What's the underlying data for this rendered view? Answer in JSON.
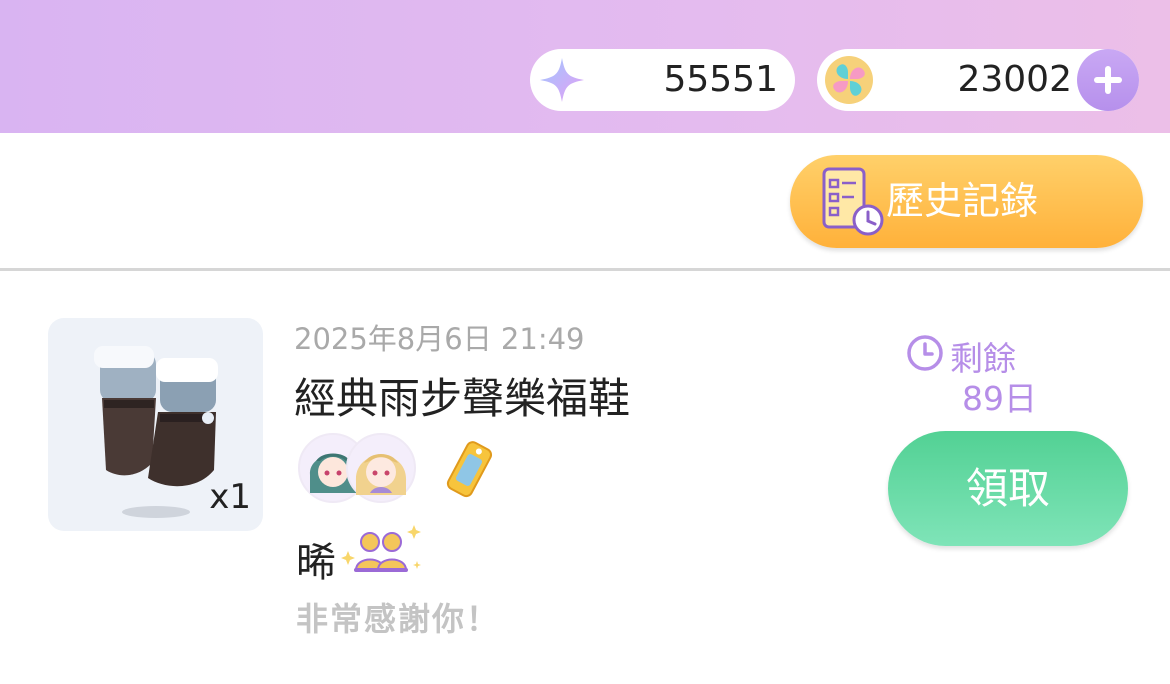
{
  "header": {
    "stars": {
      "icon": "sparkle-star-icon",
      "value": "55551"
    },
    "clover": {
      "icon": "four-leaf-clover-icon",
      "value": "23002",
      "add_icon": "plus-icon"
    },
    "colors": {
      "bar": "#e0b8f0",
      "plus": "#bf9cf0"
    }
  },
  "toolbar": {
    "history_label": "歷史記錄",
    "history_icon": "checklist-clock-icon",
    "history_color": "#ffb940"
  },
  "gift": {
    "item_icon": "boots-icon",
    "quantity": "x1",
    "timestamp": "2025年8月6日 21:49",
    "name": "經典雨步聲樂福鞋",
    "avatar_icons": [
      "chibi-avatar-teal-hair",
      "chibi-avatar-blonde-hair"
    ],
    "badge_icon": "golden-tag-icon",
    "sender_name": "晞",
    "sender_emoji": "couple-sparkle-emoji",
    "message": "非常感謝你！",
    "remaining_icon": "clock-icon",
    "remaining_label": "剩餘",
    "remaining_days": "89日",
    "claim_label": "領取",
    "colors": {
      "remaining": "#b68ee8",
      "claim": "#5fd8a2"
    }
  }
}
